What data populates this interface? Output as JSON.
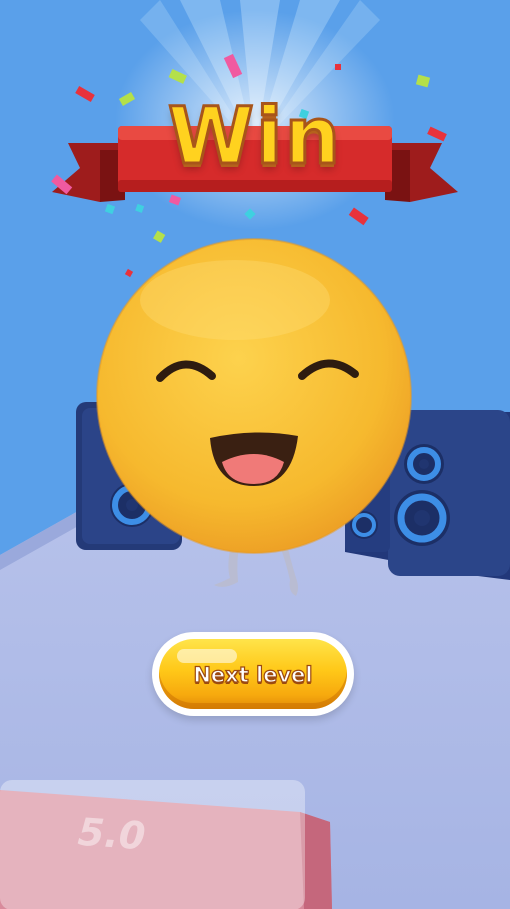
{
  "result": {
    "title": "Win"
  },
  "actions": {
    "next_level_label": "Next level"
  },
  "hud": {
    "speed_value": "5.0"
  },
  "colors": {
    "sky": "#5aa0ea",
    "floor": "#a9b8e6",
    "banner_red": "#d62b2b",
    "title_gold": "#ffd21f",
    "emoji_yellow": "#f6b92e",
    "speaker_navy": "#263f80",
    "speaker_ring": "#3d8ee6",
    "button_gold": "#ffc818"
  }
}
